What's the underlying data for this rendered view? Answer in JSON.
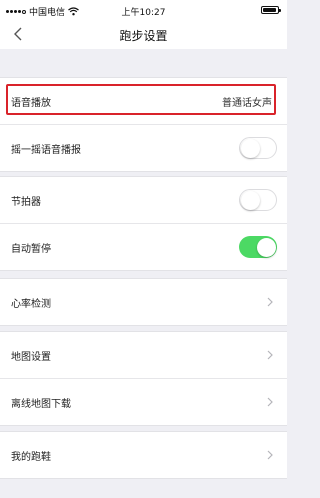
{
  "status_bar": {
    "carrier": "中国电信",
    "time": "上午10:27",
    "signal_bars_filled": 4,
    "signal_bars_total": 5
  },
  "nav": {
    "title": "跑步设置"
  },
  "colors": {
    "accent_green": "#4cd964",
    "highlight_red": "#d9232a",
    "background": "#efeff4"
  },
  "settings": {
    "voice_broadcast": {
      "label": "语音播放",
      "value": "普通话女声"
    },
    "shake_voice": {
      "label": "摇一摇语音播报",
      "enabled": false
    },
    "metronome": {
      "label": "节拍器",
      "enabled": false
    },
    "auto_pause": {
      "label": "自动暂停",
      "enabled": true
    },
    "heart_rate": {
      "label": "心率检测"
    },
    "map_settings": {
      "label": "地图设置"
    },
    "offline_map": {
      "label": "离线地图下载"
    },
    "my_shoes": {
      "label": "我的跑鞋"
    }
  }
}
